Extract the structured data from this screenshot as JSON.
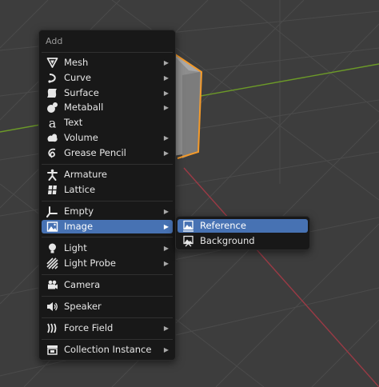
{
  "menu": {
    "title": "Add",
    "items": [
      {
        "label": "Mesh",
        "icon": "mesh-icon",
        "submenu": true
      },
      {
        "label": "Curve",
        "icon": "curve-icon",
        "submenu": true
      },
      {
        "label": "Surface",
        "icon": "surface-icon",
        "submenu": true
      },
      {
        "label": "Metaball",
        "icon": "metaball-icon",
        "submenu": true
      },
      {
        "label": "Text",
        "icon": "text-icon",
        "submenu": false
      },
      {
        "label": "Volume",
        "icon": "volume-icon",
        "submenu": true
      },
      {
        "label": "Grease Pencil",
        "icon": "grease-pencil-icon",
        "submenu": true
      },
      {
        "label": "Armature",
        "icon": "armature-icon",
        "submenu": false
      },
      {
        "label": "Lattice",
        "icon": "lattice-icon",
        "submenu": false
      },
      {
        "label": "Empty",
        "icon": "empty-icon",
        "submenu": true
      },
      {
        "label": "Image",
        "icon": "image-icon",
        "submenu": true,
        "active": true
      },
      {
        "label": "Light",
        "icon": "light-icon",
        "submenu": true
      },
      {
        "label": "Light Probe",
        "icon": "light-probe-icon",
        "submenu": true
      },
      {
        "label": "Camera",
        "icon": "camera-icon",
        "submenu": false
      },
      {
        "label": "Speaker",
        "icon": "speaker-icon",
        "submenu": false
      },
      {
        "label": "Force Field",
        "icon": "force-field-icon",
        "submenu": true
      },
      {
        "label": "Collection Instance",
        "icon": "collection-instance-icon",
        "submenu": true
      }
    ]
  },
  "submenu": {
    "items": [
      {
        "label": "Reference",
        "icon": "image-reference-icon",
        "active": true
      },
      {
        "label": "Background",
        "icon": "image-background-icon"
      }
    ]
  },
  "colors": {
    "viewport_bg": "#3d3d3d",
    "grid_line": "#4a4a4a",
    "x_axis": "#9b3a45",
    "y_axis": "#6c9a28",
    "object_face": "#8f8f8f",
    "selection_outline": "#f39a2b",
    "menu_bg": "#181818",
    "highlight": "#4772b3"
  }
}
